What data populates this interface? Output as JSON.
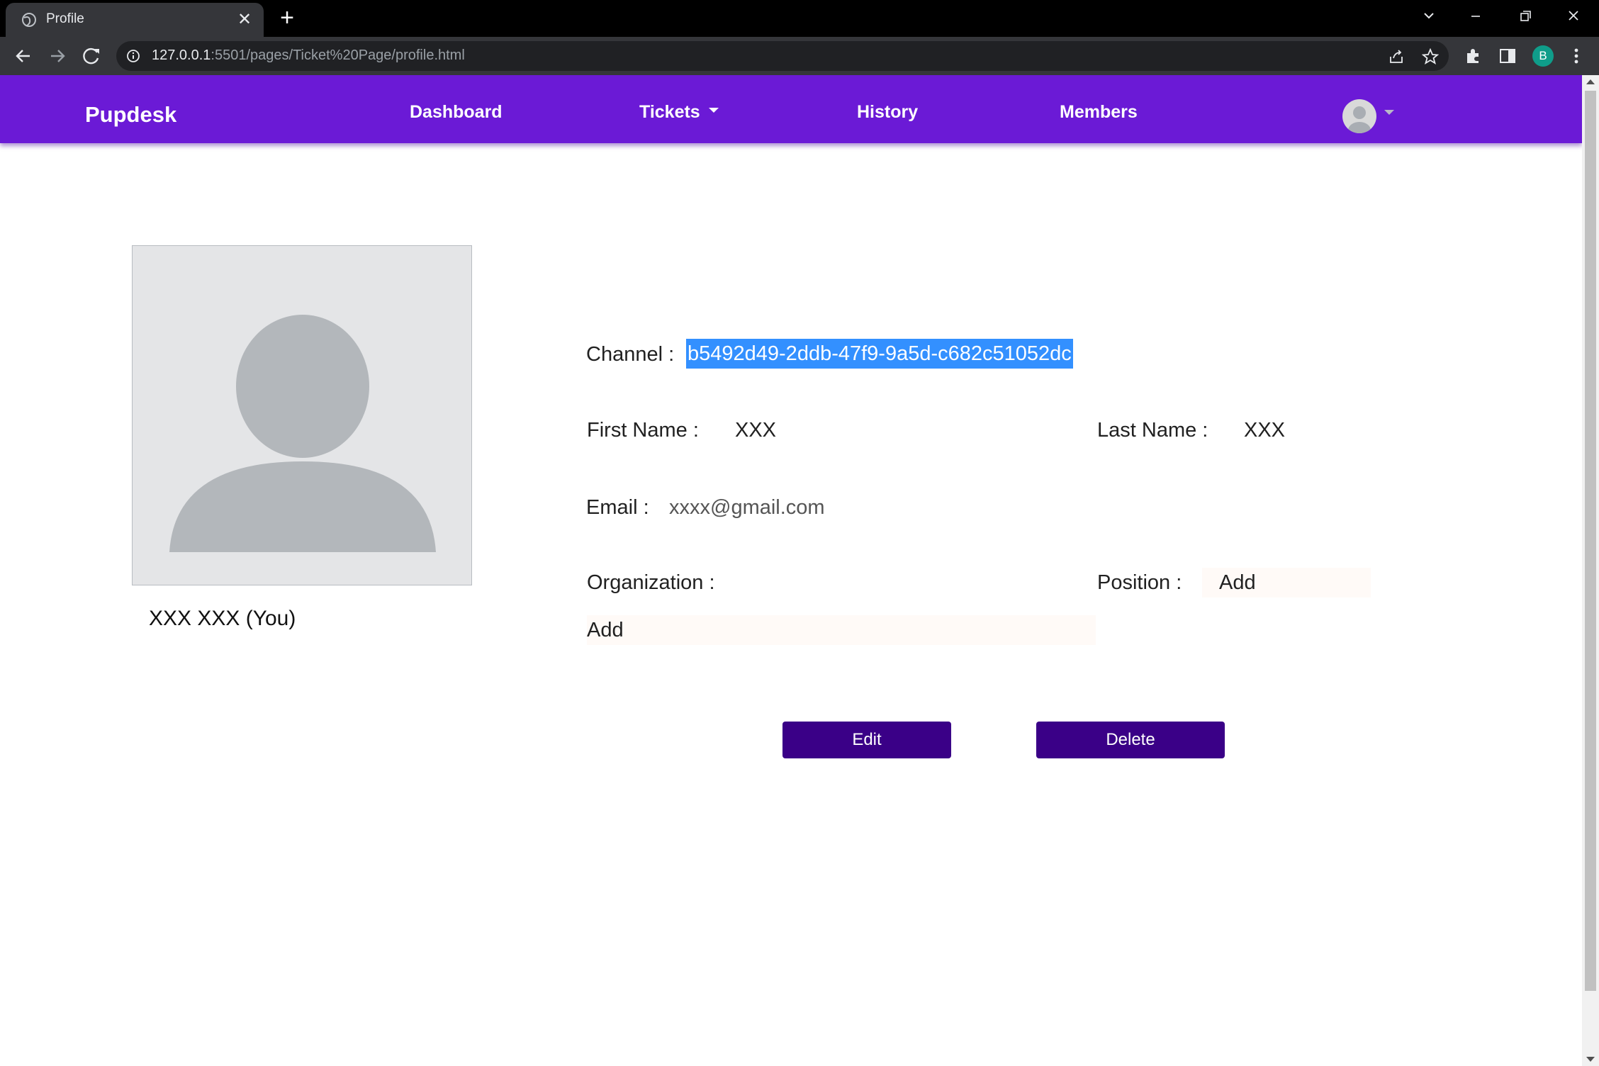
{
  "browser": {
    "tab_title": "Profile",
    "url_host": "127.0.0.1",
    "url_rest": ":5501/pages/Ticket%20Page/profile.html",
    "profile_initial": "B"
  },
  "nav": {
    "brand": "Pupdesk",
    "links": [
      "Dashboard",
      "Tickets",
      "History",
      "Members"
    ],
    "accent_color": "#6b1ad6"
  },
  "profile": {
    "display_name": "XXX XXX (You)",
    "channel_label": "Channel :",
    "channel_value": "b5492d49-2ddb-47f9-9a5d-c682c51052dc",
    "first_name_label": "First Name :",
    "first_name_value": "XXX",
    "last_name_label": "Last Name :",
    "last_name_value": "XXX",
    "email_label": "Email :",
    "email_value": "xxxx@gmail.com",
    "organization_label": "Organization :",
    "organization_value": "Add",
    "position_label": "Position :",
    "position_value": "Add"
  },
  "actions": {
    "edit_label": "Edit",
    "delete_label": "Delete",
    "button_color": "#3a0087"
  }
}
